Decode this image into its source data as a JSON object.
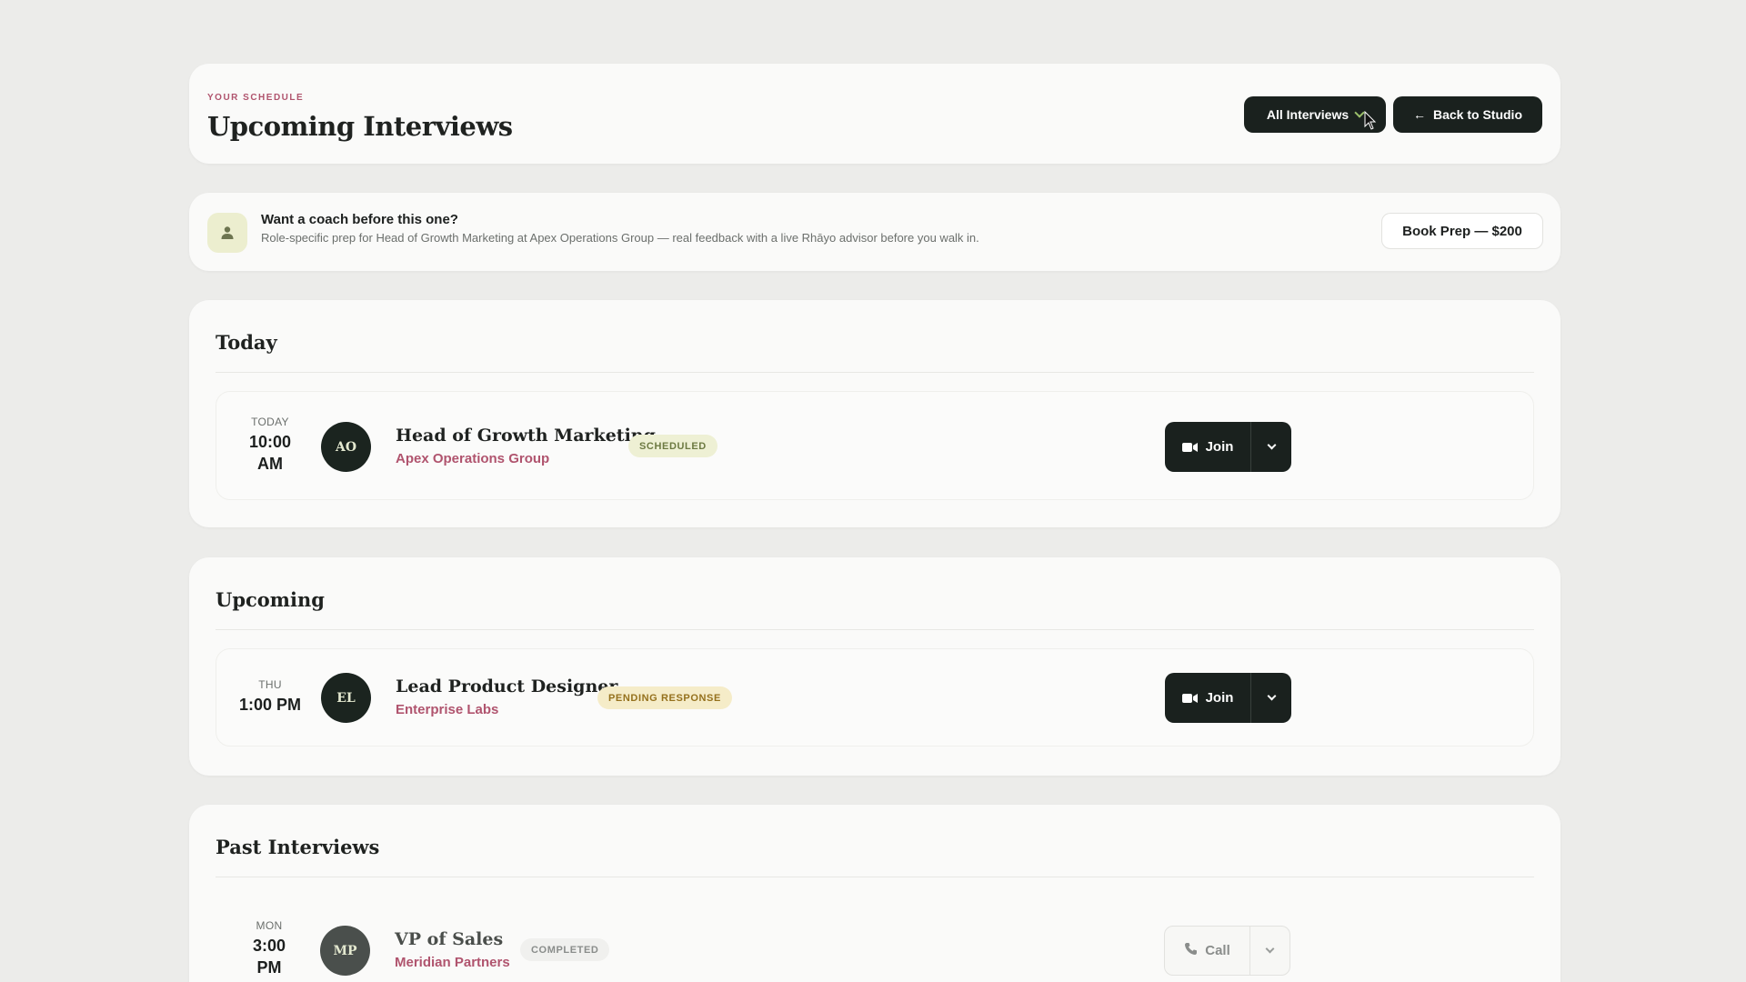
{
  "header": {
    "eyebrow": "YOUR SCHEDULE",
    "title": "Upcoming Interviews",
    "filter_label": "All Interviews",
    "back_label": "Back to Studio",
    "back_arrow": "←"
  },
  "promo": {
    "icon": "user-icon",
    "title": "Want a coach before this one?",
    "description": "Role-specific prep for Head of Growth Marketing at Apex Operations Group — real feedback with a live Rhāyo advisor before you walk in.",
    "button_label": "Book Prep — $200"
  },
  "sections": {
    "today": {
      "title": "Today",
      "row": {
        "day": "TODAY",
        "time_line1": "10:00",
        "time_line2": "AM",
        "initials": "AO",
        "role": "Head of Growth Marketing",
        "company": "Apex Operations Group",
        "status": "SCHEDULED",
        "action_label": "Join",
        "action_icon": "video-icon"
      }
    },
    "upcoming": {
      "title": "Upcoming",
      "row": {
        "day": "THU",
        "time": "1:00 PM",
        "initials": "EL",
        "role": "Lead Product Designer",
        "company": "Enterprise Labs",
        "status": "PENDING RESPONSE",
        "action_label": "Join",
        "action_icon": "video-icon"
      }
    },
    "past": {
      "title": "Past Interviews",
      "row": {
        "day": "MON",
        "time_line1": "3:00",
        "time_line2": "PM",
        "initials": "MP",
        "role": "VP of Sales",
        "company": "Meridian Partners",
        "status": "COMPLETED",
        "action_label": "Call",
        "action_icon": "phone-icon"
      }
    }
  },
  "colors": {
    "accent_pink": "#b0546e",
    "dark": "#1a211e",
    "background": "#ececea"
  }
}
